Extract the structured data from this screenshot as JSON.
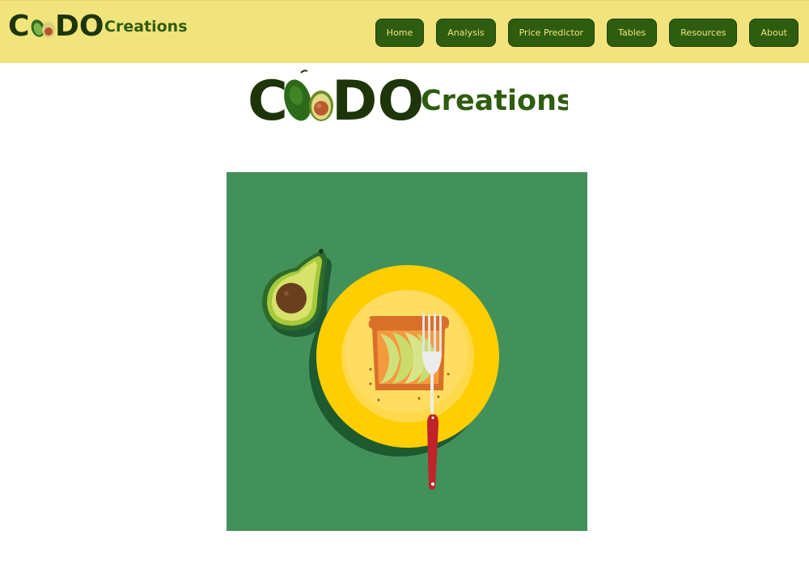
{
  "brand": {
    "logo_letter_c": "C",
    "logo_letters_do": "DO",
    "logo_word": "Creations"
  },
  "nav": {
    "items": [
      {
        "label": "Home"
      },
      {
        "label": "Analysis"
      },
      {
        "label": "Price Predictor"
      },
      {
        "label": "Tables"
      },
      {
        "label": "Resources"
      },
      {
        "label": "About"
      }
    ]
  },
  "colors": {
    "navbar_bg": "#f1e47c",
    "button_bg": "#2f5d0f",
    "button_text": "#f1e47c",
    "logo_dark": "#1d3509",
    "hero_bg": "#43915a"
  }
}
